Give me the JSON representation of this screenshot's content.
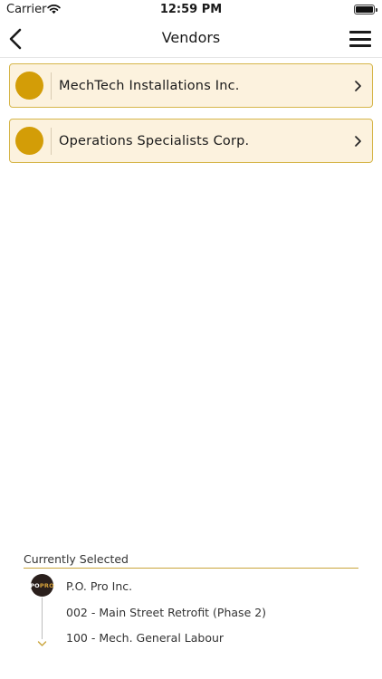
{
  "status_bar": {
    "carrier": "Carrier",
    "time": "12:59 PM"
  },
  "nav": {
    "title": "Vendors"
  },
  "vendors": [
    {
      "name": "MechTech Installations Inc."
    },
    {
      "name": "Operations Specialists Corp."
    }
  ],
  "selected": {
    "header": "Currently Selected",
    "logo_text_1": "PO",
    "logo_text_2": "PRO",
    "company": "P.O. Pro Inc.",
    "project": "002 - Main Street Retrofit (Phase 2)",
    "cost_code": "100 - Mech. General Labour"
  },
  "colors": {
    "accent": "#d39d07",
    "card_bg": "#fcf2de",
    "card_border": "#d6b64a"
  },
  "icons": {
    "back": "chevron-left-icon",
    "menu": "hamburger-icon",
    "row": "chevron-right-icon",
    "expand": "chevron-down-icon"
  }
}
